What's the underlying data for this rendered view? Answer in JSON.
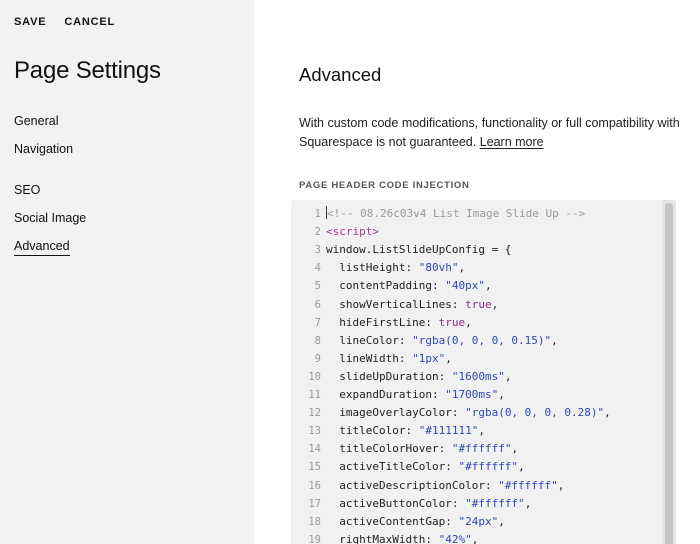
{
  "sidebar": {
    "save_label": "SAVE",
    "cancel_label": "CANCEL",
    "title": "Page Settings",
    "nav": [
      {
        "label": "General"
      },
      {
        "label": "Navigation"
      },
      {
        "label": "SEO"
      },
      {
        "label": "Social Image"
      },
      {
        "label": "Advanced",
        "active": true
      }
    ]
  },
  "main": {
    "title": "Advanced",
    "description": "With custom code modifications, functionality or full compatibility with Squarespace is not guaranteed.",
    "learn_more": "Learn more",
    "section_label": "PAGE HEADER CODE INJECTION"
  },
  "code_lines": [
    {
      "n": "1",
      "parts": [
        {
          "c": "comment",
          "t": "<!-- 08.26c03v4 List Image Slide Up -->"
        }
      ],
      "cursor": true
    },
    {
      "n": "2",
      "parts": [
        {
          "c": "tag",
          "t": "<script>"
        }
      ]
    },
    {
      "n": "3",
      "parts": [
        {
          "c": "plain",
          "t": "window.ListSlideUpConfig = {"
        }
      ]
    },
    {
      "n": "4",
      "parts": [
        {
          "c": "plain",
          "t": "  listHeight: "
        },
        {
          "c": "str",
          "t": "\"80vh\""
        },
        {
          "c": "plain",
          "t": ","
        }
      ]
    },
    {
      "n": "5",
      "parts": [
        {
          "c": "plain",
          "t": "  contentPadding: "
        },
        {
          "c": "str",
          "t": "\"40px\""
        },
        {
          "c": "plain",
          "t": ","
        }
      ]
    },
    {
      "n": "6",
      "parts": [
        {
          "c": "plain",
          "t": "  showVerticalLines: "
        },
        {
          "c": "bool",
          "t": "true"
        },
        {
          "c": "plain",
          "t": ","
        }
      ]
    },
    {
      "n": "7",
      "parts": [
        {
          "c": "plain",
          "t": "  hideFirstLine: "
        },
        {
          "c": "bool",
          "t": "true"
        },
        {
          "c": "plain",
          "t": ","
        }
      ]
    },
    {
      "n": "8",
      "parts": [
        {
          "c": "plain",
          "t": "  lineColor: "
        },
        {
          "c": "str",
          "t": "\"rgba(0, 0, 0, 0.15)\""
        },
        {
          "c": "plain",
          "t": ","
        }
      ]
    },
    {
      "n": "9",
      "parts": [
        {
          "c": "plain",
          "t": "  lineWidth: "
        },
        {
          "c": "str",
          "t": "\"1px\""
        },
        {
          "c": "plain",
          "t": ","
        }
      ]
    },
    {
      "n": "10",
      "parts": [
        {
          "c": "plain",
          "t": "  slideUpDuration: "
        },
        {
          "c": "str",
          "t": "\"1600ms\""
        },
        {
          "c": "plain",
          "t": ","
        }
      ]
    },
    {
      "n": "11",
      "parts": [
        {
          "c": "plain",
          "t": "  expandDuration: "
        },
        {
          "c": "str",
          "t": "\"1700ms\""
        },
        {
          "c": "plain",
          "t": ","
        }
      ]
    },
    {
      "n": "12",
      "parts": [
        {
          "c": "plain",
          "t": "  imageOverlayColor: "
        },
        {
          "c": "str",
          "t": "\"rgba(0, 0, 0, 0.28)\""
        },
        {
          "c": "plain",
          "t": ","
        }
      ]
    },
    {
      "n": "13",
      "parts": [
        {
          "c": "plain",
          "t": "  titleColor: "
        },
        {
          "c": "str",
          "t": "\"#111111\""
        },
        {
          "c": "plain",
          "t": ","
        }
      ]
    },
    {
      "n": "14",
      "parts": [
        {
          "c": "plain",
          "t": "  titleColorHover: "
        },
        {
          "c": "str",
          "t": "\"#ffffff\""
        },
        {
          "c": "plain",
          "t": ","
        }
      ]
    },
    {
      "n": "15",
      "parts": [
        {
          "c": "plain",
          "t": "  activeTitleColor: "
        },
        {
          "c": "str",
          "t": "\"#ffffff\""
        },
        {
          "c": "plain",
          "t": ","
        }
      ]
    },
    {
      "n": "16",
      "parts": [
        {
          "c": "plain",
          "t": "  activeDescriptionColor: "
        },
        {
          "c": "str",
          "t": "\"#ffffff\""
        },
        {
          "c": "plain",
          "t": ","
        }
      ]
    },
    {
      "n": "17",
      "parts": [
        {
          "c": "plain",
          "t": "  activeButtonColor: "
        },
        {
          "c": "str",
          "t": "\"#ffffff\""
        },
        {
          "c": "plain",
          "t": ","
        }
      ]
    },
    {
      "n": "18",
      "parts": [
        {
          "c": "plain",
          "t": "  activeContentGap: "
        },
        {
          "c": "str",
          "t": "\"24px\""
        },
        {
          "c": "plain",
          "t": ","
        }
      ]
    },
    {
      "n": "19",
      "parts": [
        {
          "c": "plain",
          "t": "  rightMaxWidth: "
        },
        {
          "c": "str",
          "t": "\"42%\""
        },
        {
          "c": "plain",
          "t": ","
        }
      ]
    }
  ]
}
